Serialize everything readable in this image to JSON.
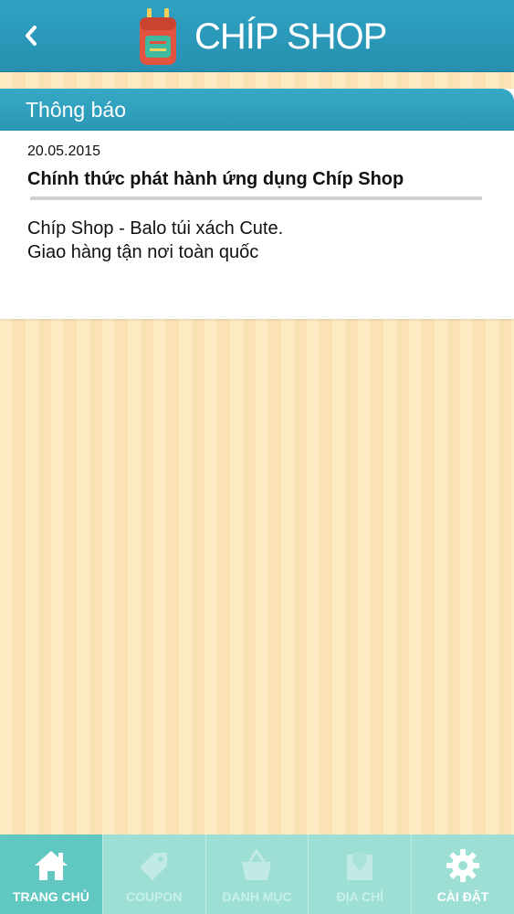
{
  "header": {
    "brand": "CHÍP SHOP",
    "back_icon": "chevron-left-icon",
    "logo_icon": "backpack-icon"
  },
  "panel": {
    "title": "Thông báo",
    "date": "20.05.2015",
    "notice_title": "Chính thức phát hành ứng dụng Chíp Shop",
    "notice_body_line1": "Chíp Shop - Balo túi xách Cute.",
    "notice_body_line2": "Giao hàng tận nơi toàn quốc"
  },
  "tabs": [
    {
      "label": "TRANG CHỦ",
      "icon": "home-icon",
      "active": true
    },
    {
      "label": "COUPON",
      "icon": "tag-icon",
      "active": false
    },
    {
      "label": "DANH MỤC",
      "icon": "basket-icon",
      "active": false
    },
    {
      "label": "ĐỊA CHỈ",
      "icon": "map-icon",
      "active": false
    },
    {
      "label": "CÀI ĐẶT",
      "icon": "gear-icon",
      "active": false
    }
  ],
  "colors": {
    "header_bg": "#2b9ab9",
    "active_tab_bg": "#61c7c1",
    "tabbar_bg": "#9edfd5",
    "background_stripe_light": "#fde9c2",
    "background_stripe_dark": "#fbe2b4"
  }
}
